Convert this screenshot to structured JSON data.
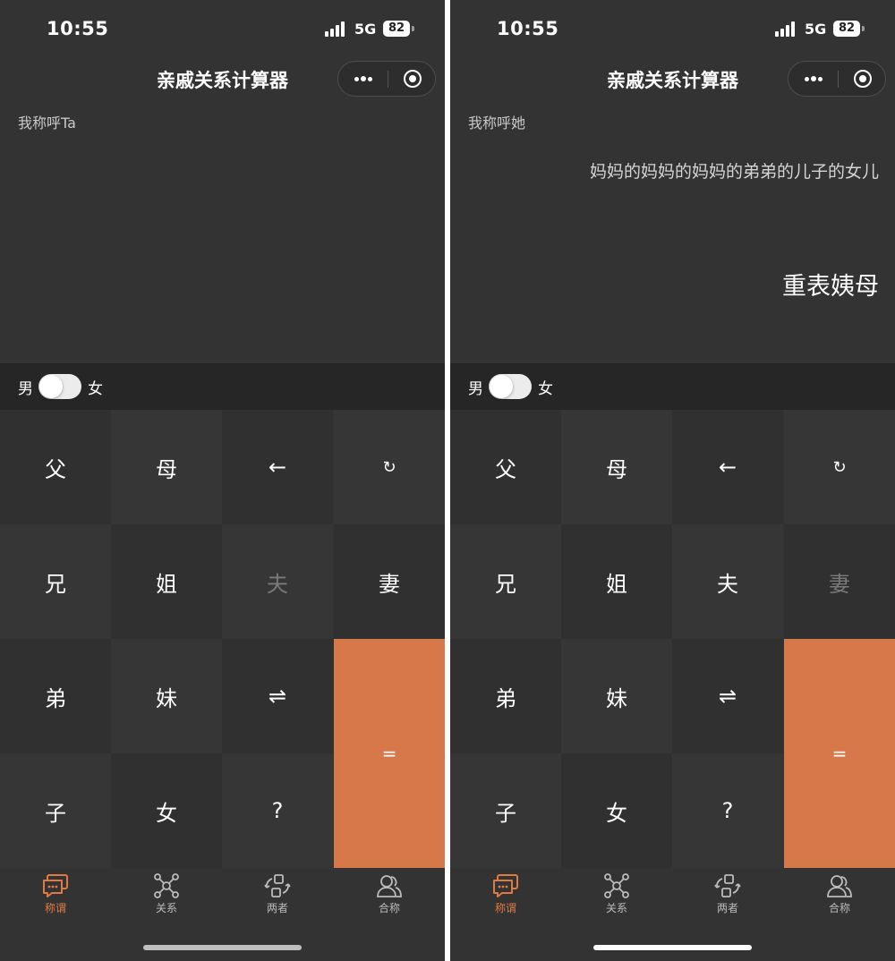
{
  "colors": {
    "accent": "#d7784a",
    "background": "#333333",
    "tab_active": "#e07a45"
  },
  "screens": [
    {
      "status": {
        "time": "10:55",
        "network": "5G",
        "battery": "82"
      },
      "title": "亲戚关系计算器",
      "prompt": "我称呼Ta",
      "expression": "",
      "result": "",
      "gender": {
        "male": "男",
        "female": "女"
      },
      "keys": {
        "father": "父",
        "mother": "母",
        "backspace": "←",
        "reset": "↻",
        "elder_brother": "兄",
        "elder_sister": "姐",
        "husband": "夫",
        "wife": "妻",
        "younger_brother": "弟",
        "younger_sister": "妹",
        "swap": "⇌",
        "equals": "=",
        "son": "子",
        "daughter": "女",
        "question": "?"
      },
      "tabs": {
        "address": "称谓",
        "relation": "关系",
        "both": "两者",
        "joint": "合称"
      }
    },
    {
      "status": {
        "time": "10:55",
        "network": "5G",
        "battery": "82"
      },
      "title": "亲戚关系计算器",
      "prompt": "我称呼她",
      "expression": "妈妈的妈妈的妈妈的弟弟的儿子的女儿",
      "result": "重表姨母",
      "gender": {
        "male": "男",
        "female": "女"
      },
      "keys": {
        "father": "父",
        "mother": "母",
        "backspace": "←",
        "reset": "↻",
        "elder_brother": "兄",
        "elder_sister": "姐",
        "husband": "夫",
        "wife": "妻",
        "younger_brother": "弟",
        "younger_sister": "妹",
        "swap": "⇌",
        "equals": "=",
        "son": "子",
        "daughter": "女",
        "question": "?"
      },
      "tabs": {
        "address": "称谓",
        "relation": "关系",
        "both": "两者",
        "joint": "合称"
      }
    }
  ]
}
